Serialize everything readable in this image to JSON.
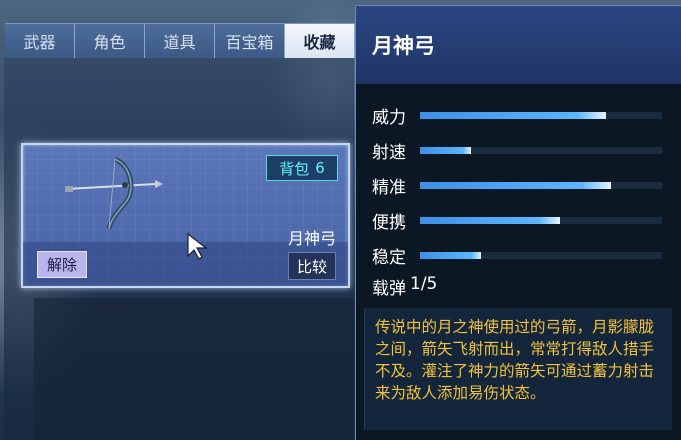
{
  "tabs": [
    {
      "label": "武器",
      "active": false
    },
    {
      "label": "角色",
      "active": false
    },
    {
      "label": "道具",
      "active": false
    },
    {
      "label": "百宝箱",
      "active": false
    },
    {
      "label": "收藏",
      "active": true
    }
  ],
  "item_card": {
    "bag_label": "背包",
    "bag_count": "6",
    "item_name": "月神弓",
    "unequip_label": "解除",
    "compare_label": "比较",
    "image_icon": "bow-icon"
  },
  "details": {
    "title": "月神弓",
    "stats": [
      {
        "label": "威力",
        "value": 0.77
      },
      {
        "label": "射速",
        "value": 0.21
      },
      {
        "label": "精准",
        "value": 0.79
      },
      {
        "label": "便携",
        "value": 0.58
      },
      {
        "label": "稳定",
        "value": 0.25
      }
    ],
    "ammo_label": "载弹",
    "ammo_value": "1/5",
    "description": "传说中的月之神使用过的弓箭，月影朦胧之间，箭矢飞射而出，常常打得敌人措手不及。灌注了神力的箭矢可通过蓄力射击来为敌人添加易伤状态。"
  },
  "colors": {
    "accent_cyan": "#5ff0ff",
    "stat_bar": "#5cb6ff",
    "description_text": "#f2c23a"
  }
}
